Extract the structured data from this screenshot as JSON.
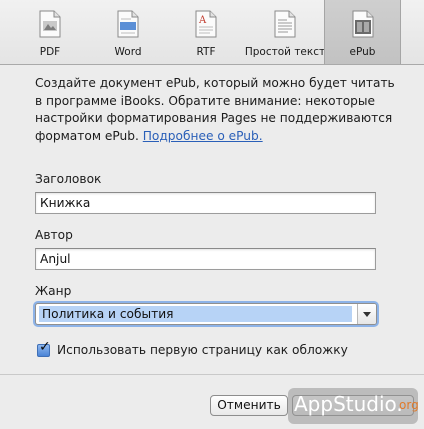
{
  "toolbar": {
    "items": [
      {
        "label": "PDF",
        "icon": "pdf-document-icon"
      },
      {
        "label": "Word",
        "icon": "word-document-icon"
      },
      {
        "label": "RTF",
        "icon": "rtf-document-icon"
      },
      {
        "label": "Простой текст",
        "icon": "plain-text-document-icon"
      },
      {
        "label": "ePub",
        "icon": "epub-document-icon",
        "selected": true
      }
    ]
  },
  "description": {
    "text": "Создайте документ ePub, который можно будет читать в программе iBooks. Обратите внимание: некоторые настройки форматирования Pages не поддерживаются форматом ePub. ",
    "link": "Подробнее о ePub."
  },
  "form": {
    "title_label": "Заголовок",
    "title_value": "Книжка",
    "author_label": "Автор",
    "author_value": "Anjul",
    "genre_label": "Жанр",
    "genre_value": "Политика и события",
    "cover_checkbox_label": "Использовать первую страницу как обложку",
    "cover_checked": true
  },
  "buttons": {
    "cancel_label": "Отменить"
  },
  "watermark": {
    "main": "AppStudio.",
    "suffix": "org"
  },
  "colors": {
    "link": "#2a5fb8",
    "selection": "#b7d3f6",
    "focus_ring": "#8db3e8",
    "checkbox": "#4a84d6"
  }
}
